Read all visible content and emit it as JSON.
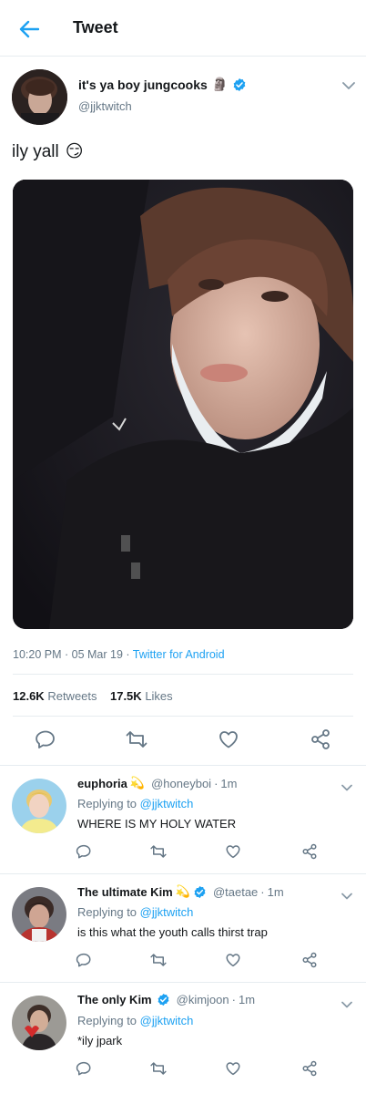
{
  "header": {
    "title": "Tweet"
  },
  "main_tweet": {
    "author_name": "it's ya boy jungcooks",
    "author_emoji": "🗿",
    "author_handle": "@jjktwitch",
    "text": "ily yall",
    "text_emoji": "😏",
    "time": "10:20 PM",
    "dot1": " · ",
    "date": "05 Mar 19",
    "dot2": " · ",
    "source": "Twitter for Android",
    "retweets_count": "12.6K",
    "retweets_label": "Retweets",
    "likes_count": "17.5K",
    "likes_label": "Likes"
  },
  "replies": [
    {
      "name": "euphoria",
      "name_emoji": "💫",
      "verified": false,
      "handle": "@honeyboi",
      "dot": " · ",
      "time": "1m",
      "replying_prefix": "Replying to ",
      "replying_to": "@jjktwitch",
      "text": "WHERE IS MY HOLY WATER"
    },
    {
      "name": "The ultimate Kim",
      "name_emoji": "💫",
      "verified": true,
      "handle": "@taetae",
      "dot": " · ",
      "time": "1m",
      "replying_prefix": "Replying to ",
      "replying_to": "@jjktwitch",
      "text": "is this what the youth calls thirst trap"
    },
    {
      "name": "The only Kim",
      "name_emoji": "",
      "verified": true,
      "handle": "@kimjoon",
      "dot": " · ",
      "time": "1m",
      "replying_prefix": "Replying to ",
      "replying_to": "@jjktwitch",
      "text": "*ily jpark"
    }
  ],
  "colors": {
    "accent": "#1da1f2",
    "secondary_text": "#657786",
    "primary_text": "#14171a",
    "divider": "#e6ecf0"
  },
  "icons": [
    "back-arrow-icon",
    "verified-badge-icon",
    "chevron-down-icon",
    "reply-icon",
    "retweet-icon",
    "like-icon",
    "share-icon"
  ]
}
